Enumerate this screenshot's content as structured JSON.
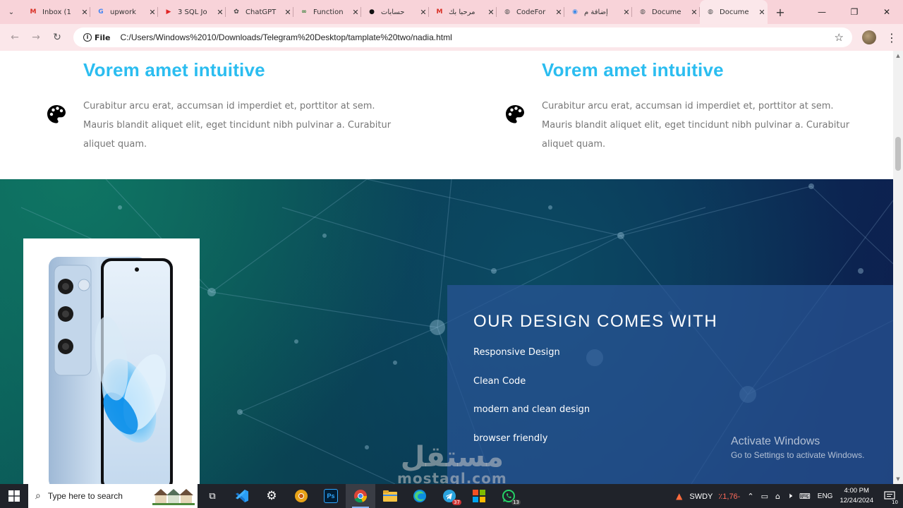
{
  "browser": {
    "tabs": [
      {
        "title": "Inbox (1",
        "icon": "gmail-icon",
        "color": "#d93025",
        "glyph": "M"
      },
      {
        "title": "upwork",
        "icon": "google-icon",
        "color": "#4285f4",
        "glyph": "G"
      },
      {
        "title": "3 SQL Jo",
        "icon": "youtube-icon",
        "color": "#e02424",
        "glyph": "▶"
      },
      {
        "title": "ChatGPT",
        "icon": "chatgpt-icon",
        "color": "#444444",
        "glyph": "✿"
      },
      {
        "title": "Function",
        "icon": "function-icon",
        "color": "#2e7d32",
        "glyph": "∞"
      },
      {
        "title": "حسابات",
        "icon": "threads-icon",
        "color": "#111111",
        "glyph": "●"
      },
      {
        "title": "مرحبا بك",
        "icon": "gmail-icon",
        "color": "#d93025",
        "glyph": "M"
      },
      {
        "title": "CodeFor",
        "icon": "globe-icon",
        "color": "#555555",
        "glyph": "◍"
      },
      {
        "title": "إضافة م",
        "icon": "circle-icon",
        "color": "#3d8be8",
        "glyph": "◉"
      },
      {
        "title": "Docume",
        "icon": "globe-icon",
        "color": "#555555",
        "glyph": "◍"
      },
      {
        "title": "Docume",
        "icon": "globe-icon",
        "color": "#555555",
        "glyph": "◍",
        "active": true
      }
    ],
    "address": {
      "scheme_chip": "File",
      "url": "C:/Users/Windows%2010/Downloads/Telegram%20Desktop/tamplate%20two/nadia.html"
    }
  },
  "page": {
    "features": [
      {
        "title": "Vorem amet intuitive",
        "text": "Curabitur arcu erat, accumsan id imperdiet et, porttitor at sem. Mauris blandit aliquet elit, eget tincidunt nibh pulvinar a. Curabitur aliquet quam."
      },
      {
        "title": "Vorem amet intuitive",
        "text": "Curabitur arcu erat, accumsan id imperdiet et, porttitor at sem. Mauris blandit aliquet elit, eget tincidunt nibh pulvinar a. Curabitur aliquet quam."
      }
    ],
    "design": {
      "heading": "OUR DESIGN COMES WITH",
      "items": [
        "Responsive Design",
        "Clean Code",
        "modern and clean design",
        "browser friendly"
      ]
    },
    "activate": {
      "title": "Activate Windows",
      "subtitle": "Go to Settings to activate Windows."
    },
    "watermark": {
      "arabic": "مستقل",
      "latin": "mostaql.com"
    }
  },
  "taskbar": {
    "search_placeholder": "Type here to search",
    "stock": {
      "symbol": "SWDY",
      "change": "٪1,76-"
    },
    "language": "ENG",
    "time": "4:00 PM",
    "date": "12/24/2024",
    "notifications": "10",
    "telegram_badge": "37",
    "whatsapp_badge": "13"
  }
}
